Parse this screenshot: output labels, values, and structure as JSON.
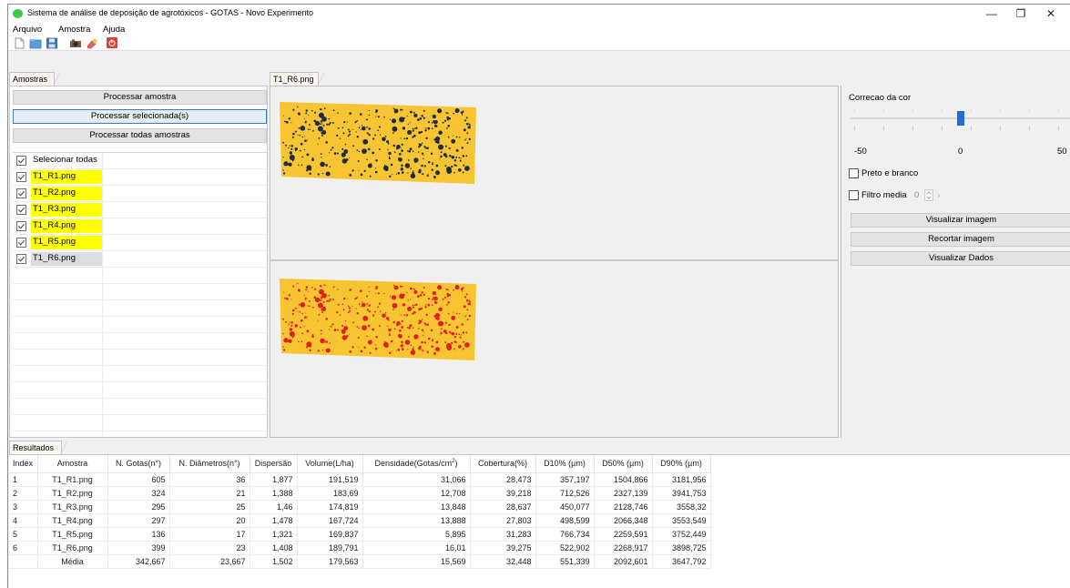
{
  "window": {
    "title": "Sistema de análise de deposição de agrotóxicos - GOTAS - Novo Experimento",
    "minimize_glyph": "—",
    "maximize_glyph": "❐",
    "close_glyph": "✕"
  },
  "menu": {
    "items": [
      "Arquivo",
      "Amostra",
      "Ajuda"
    ]
  },
  "toolbar": {
    "icons": [
      "new-file-icon",
      "open-folder-icon",
      "save-icon",
      "camera-icon",
      "eraser-icon",
      "power-icon"
    ]
  },
  "left_panel": {
    "tab_label": "Amostras",
    "buttons": {
      "process_sample": "Processar amostra",
      "process_selected": "Processar selecionada(s)",
      "process_all": "Processar todas amostras"
    },
    "select_all_label": "Selecionar todas",
    "samples": [
      {
        "name": "T1_R1.png",
        "highlight": "#ffff00"
      },
      {
        "name": "T1_R2.png",
        "highlight": "#ffff00"
      },
      {
        "name": "T1_R3.png",
        "highlight": "#ffff00"
      },
      {
        "name": "T1_R4.png",
        "highlight": "#ffff00"
      },
      {
        "name": "T1_R5.png",
        "highlight": "#ffff00"
      },
      {
        "name": "T1_R6.png",
        "highlight": "#dcdcdc"
      }
    ]
  },
  "center_panel": {
    "tab_label": "T1_R6.png"
  },
  "right_panel": {
    "color_correction_label": "Correcao da cor",
    "slider_min_label": "-50",
    "slider_mid_label": "0",
    "slider_max_label": "50",
    "slider_value": 0,
    "black_white_label": "Preto e branco",
    "median_filter_label": "Filtro media",
    "median_filter_value": "0",
    "buttons": {
      "view_image": "Visualizar imagem",
      "crop_image": "Recortar imagem",
      "view_data": "Visualizar Dados"
    }
  },
  "results": {
    "tab_label": "Resultados",
    "headers": {
      "index": "Index",
      "sample": "Amostra",
      "drops": "N. Gotas(n°)",
      "diameters": "N. Diâmetros(n°)",
      "dispersion": "Dispersão",
      "volume": "Volume(L/ha)",
      "density_prefix": "Densidade(Gotas/cm",
      "density_sup": "2",
      "density_suffix": ")",
      "coverage": "Cobertura(%)",
      "d10": "D10% (µm)",
      "d50": "D50% (µm)",
      "d90": "D90% (µm)"
    },
    "rows": [
      {
        "index": "1",
        "sample": "T1_R1.png",
        "drops": "605",
        "diameters": "36",
        "dispersion": "1,877",
        "volume": "191,519",
        "density": "31,066",
        "coverage": "28,473",
        "d10": "357,197",
        "d50": "1504,866",
        "d90": "3181,956"
      },
      {
        "index": "2",
        "sample": "T1_R2.png",
        "drops": "324",
        "diameters": "21",
        "dispersion": "1,388",
        "volume": "183,69",
        "density": "12,708",
        "coverage": "39,218",
        "d10": "712,526",
        "d50": "2327,139",
        "d90": "3941,753"
      },
      {
        "index": "3",
        "sample": "T1_R3.png",
        "drops": "295",
        "diameters": "25",
        "dispersion": "1,46",
        "volume": "174,819",
        "density": "13,848",
        "coverage": "28,637",
        "d10": "450,077",
        "d50": "2128,746",
        "d90": "3558,32"
      },
      {
        "index": "4",
        "sample": "T1_R4.png",
        "drops": "297",
        "diameters": "20",
        "dispersion": "1,478",
        "volume": "167,724",
        "density": "13,888",
        "coverage": "27,803",
        "d10": "498,599",
        "d50": "2066,348",
        "d90": "3553,549"
      },
      {
        "index": "5",
        "sample": "T1_R5.png",
        "drops": "136",
        "diameters": "17",
        "dispersion": "1,321",
        "volume": "169,837",
        "density": "5,895",
        "coverage": "31,283",
        "d10": "766,734",
        "d50": "2259,591",
        "d90": "3752,449"
      },
      {
        "index": "6",
        "sample": "T1_R6.png",
        "drops": "399",
        "diameters": "23",
        "dispersion": "1,408",
        "volume": "189,791",
        "density": "16,01",
        "coverage": "39,275",
        "d10": "522,902",
        "d50": "2268,917",
        "d90": "3898,725"
      },
      {
        "index": "",
        "sample": "Média",
        "drops": "342,667",
        "diameters": "23,667",
        "dispersion": "1,502",
        "volume": "179,563",
        "density": "15,569",
        "coverage": "32,448",
        "d10": "551,339",
        "d50": "2092,601",
        "d90": "3647,792"
      }
    ]
  },
  "colors": {
    "card_yellow": "#f7c531",
    "drop_dark": "#1e2a4a",
    "drop_red": "#e0201c",
    "selection_yellow": "#ffff00",
    "accent_blue": "#1f6fd6"
  }
}
